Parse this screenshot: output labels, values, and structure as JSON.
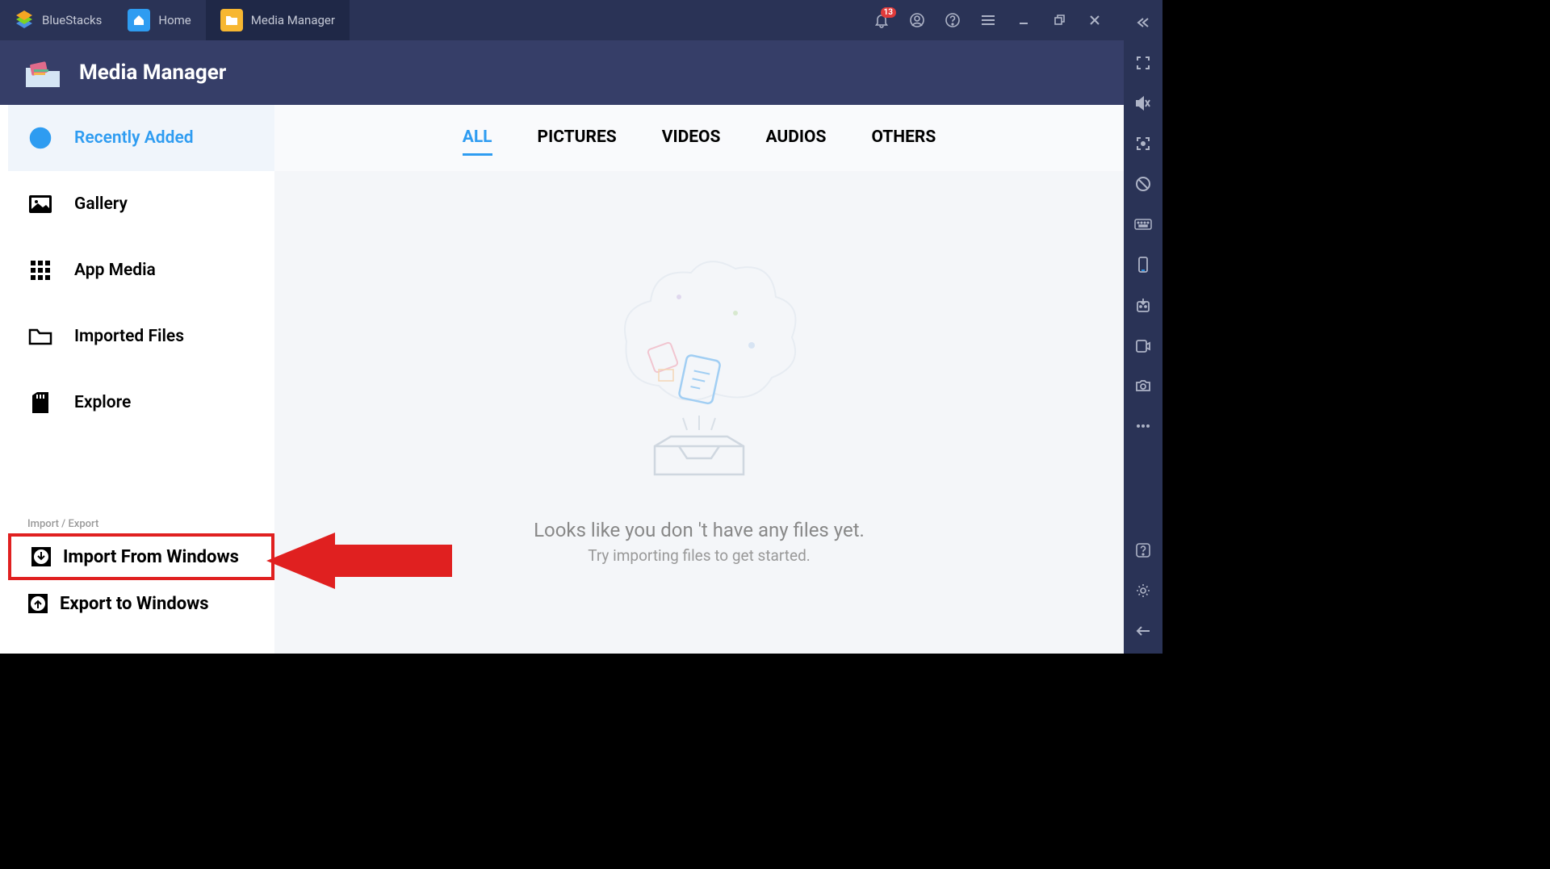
{
  "titlebar": {
    "brand": "BlueStacks",
    "tabs": [
      {
        "label": "Home",
        "icon": "home"
      },
      {
        "label": "Media Manager",
        "icon": "folder"
      }
    ],
    "notification_count": "13"
  },
  "header": {
    "title": "Media Manager"
  },
  "sidebar": {
    "items": [
      {
        "label": "Recently Added",
        "icon": "clock",
        "active": true
      },
      {
        "label": "Gallery",
        "icon": "image"
      },
      {
        "label": "App Media",
        "icon": "grid"
      },
      {
        "label": "Imported Files",
        "icon": "folder"
      },
      {
        "label": "Explore",
        "icon": "sd"
      }
    ],
    "section_label": "Import / Export",
    "ie_items": [
      {
        "label": "Import From Windows",
        "icon": "import"
      },
      {
        "label": "Export to Windows",
        "icon": "export"
      }
    ]
  },
  "filters": [
    {
      "label": "ALL",
      "active": true
    },
    {
      "label": "PICTURES"
    },
    {
      "label": "VIDEOS"
    },
    {
      "label": "AUDIOS"
    },
    {
      "label": "OTHERS"
    }
  ],
  "empty": {
    "line1": "Looks like you don 't have any files yet.",
    "line2": "Try importing files to get started."
  }
}
